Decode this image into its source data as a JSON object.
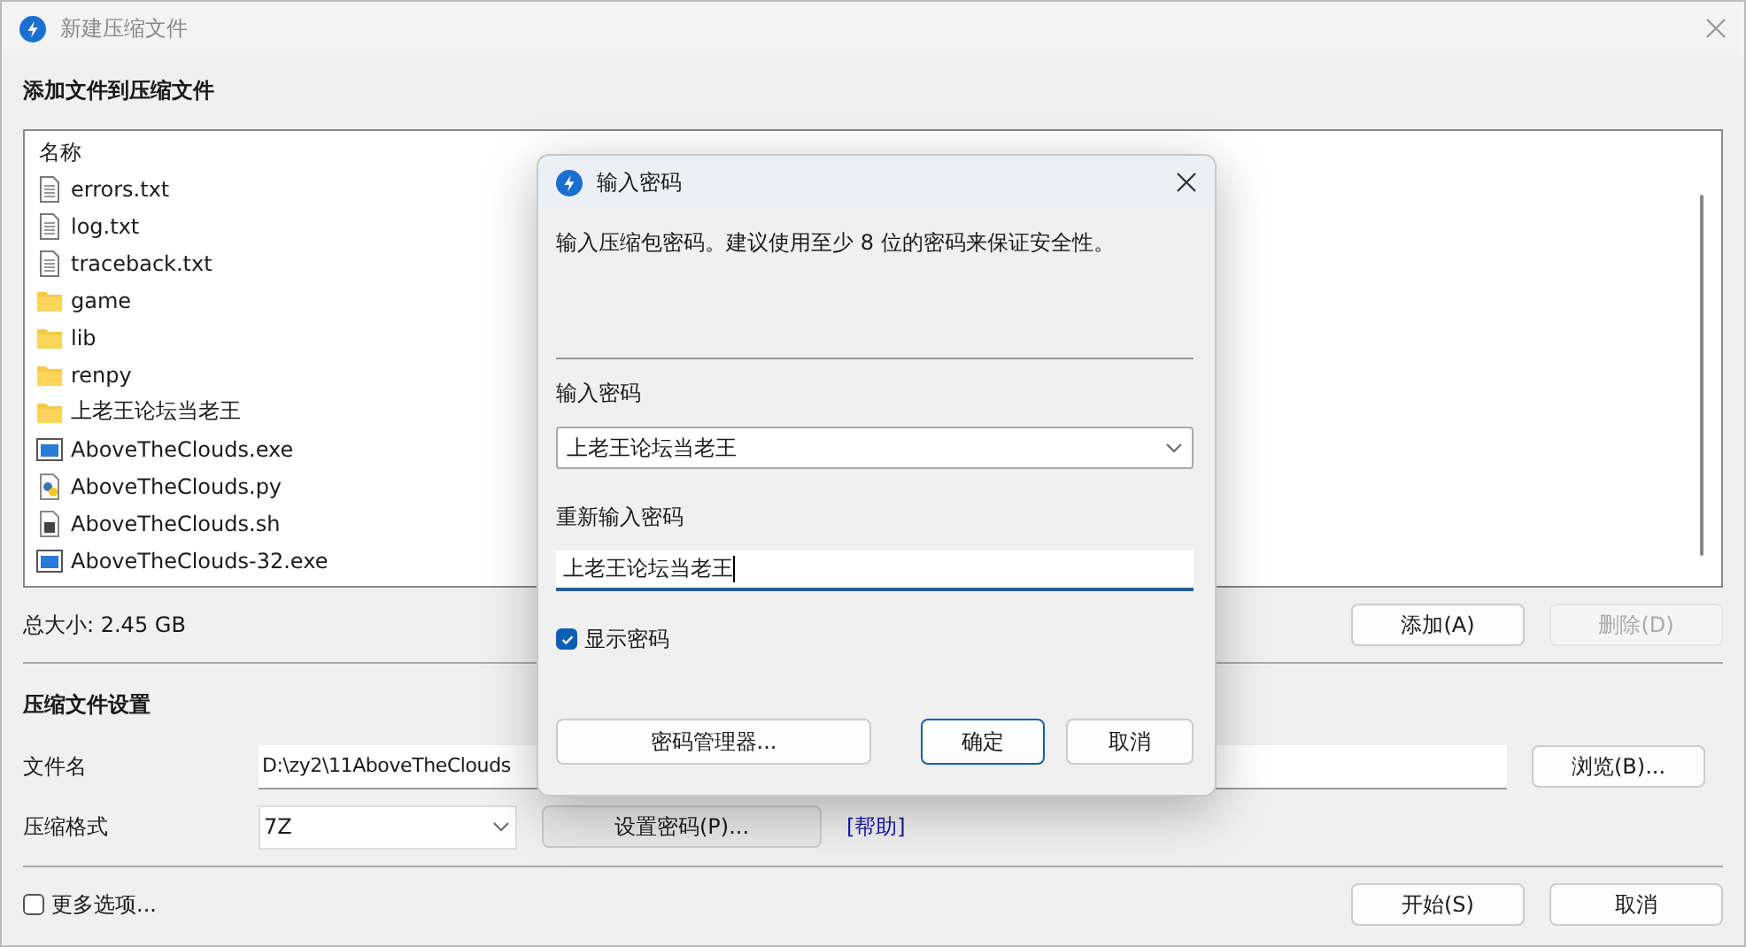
{
  "window": {
    "title": "新建压缩文件"
  },
  "add_section": {
    "heading": "添加文件到压缩文件"
  },
  "file_list": {
    "columns": [
      "名称"
    ],
    "rows": [
      {
        "name": "errors.txt",
        "kind": "text"
      },
      {
        "name": "log.txt",
        "kind": "text"
      },
      {
        "name": "traceback.txt",
        "kind": "text"
      },
      {
        "name": "game",
        "kind": "folder"
      },
      {
        "name": "lib",
        "kind": "folder"
      },
      {
        "name": "renpy",
        "kind": "folder"
      },
      {
        "name": "上老王论坛当老王",
        "kind": "folder"
      },
      {
        "name": "AboveTheClouds.exe",
        "kind": "exe"
      },
      {
        "name": "AboveTheClouds.py",
        "kind": "python"
      },
      {
        "name": "AboveTheClouds.sh",
        "kind": "script"
      },
      {
        "name": "AboveTheClouds-32.exe",
        "kind": "exe"
      }
    ]
  },
  "total_size": "总大小: 2.45 GB",
  "list_buttons": [
    {
      "label": "添加(A)",
      "disabled": false
    },
    {
      "label": "删除(D)",
      "disabled": true
    }
  ],
  "settings": {
    "heading": "压缩文件设置",
    "filename_label": "文件名",
    "filename_value": "D:\\zy2\\11AboveTheClouds",
    "browse": "浏览(B)...",
    "format_label": "压缩格式",
    "format_value": "7Z",
    "set_password": "设置密码(P)...",
    "help_link": "[帮助]"
  },
  "more_options": {
    "label": "更多选项...",
    "checked": false
  },
  "footer_buttons": [
    "开始(S)",
    "取消"
  ],
  "dialog": {
    "title": "输入密码",
    "message": "输入压缩包密码。建议使用至少 8 位的密码来保证安全性。",
    "password_label": "输入密码",
    "password_value": "上老王论坛当老王",
    "reenter_label": "重新输入密码",
    "reenter_value": "上老王论坛当老王",
    "show_password": {
      "label": "显示密码",
      "checked": true
    },
    "manager_button": "密码管理器...",
    "ok_button": "确定",
    "cancel_button": "取消"
  }
}
